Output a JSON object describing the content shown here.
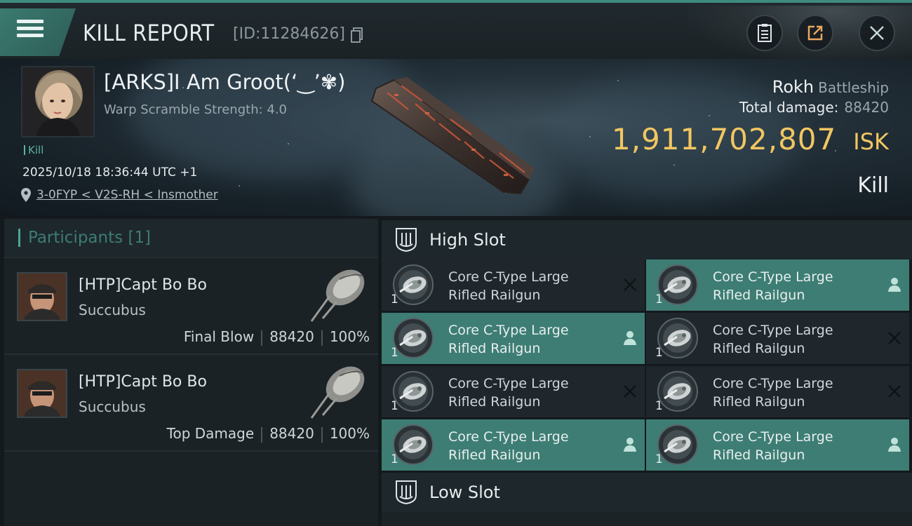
{
  "header": {
    "title": "KILL REPORT",
    "id_text": "[ID:11284626]"
  },
  "victim": {
    "name": "[ARKS]I Am Groot(‘‿’✾)",
    "warp_scramble": "Warp Scramble Strength: 4.0",
    "kill_tag": "Kill",
    "datetime": "2025/10/18 18:36:44 UTC +1",
    "location": "3-0FYP < V2S-RH < Insmother"
  },
  "ship": {
    "name": "Rokh",
    "class": "Battleship",
    "total_damage_label": "Total damage:",
    "total_damage": "88420",
    "isk_value": "1,911,702,807",
    "isk_unit": "ISK",
    "result": "Kill"
  },
  "participants": {
    "title": "Participants [1]",
    "items": [
      {
        "name": "[HTP]Capt Bo Bo",
        "ship": "Succubus",
        "role": "Final Blow",
        "damage": "88420",
        "percent": "100%"
      },
      {
        "name": "[HTP]Capt Bo Bo",
        "ship": "Succubus",
        "role": "Top Damage",
        "damage": "88420",
        "percent": "100%"
      }
    ]
  },
  "slots": {
    "high_title": "High Slot",
    "low_title": "Low Slot",
    "high_modules": [
      {
        "line1": "Core C-Type Large",
        "line2": "Rifled Railgun",
        "qty": "1",
        "status": "destroyed"
      },
      {
        "line1": "Core C-Type Large",
        "line2": "Rifled Railgun",
        "qty": "1",
        "status": "dropped"
      },
      {
        "line1": "Core C-Type Large",
        "line2": "Rifled Railgun",
        "qty": "1",
        "status": "dropped"
      },
      {
        "line1": "Core C-Type Large",
        "line2": "Rifled Railgun",
        "qty": "1",
        "status": "destroyed"
      },
      {
        "line1": "Core C-Type Large",
        "line2": "Rifled Railgun",
        "qty": "1",
        "status": "destroyed"
      },
      {
        "line1": "Core C-Type Large",
        "line2": "Rifled Railgun",
        "qty": "1",
        "status": "destroyed"
      },
      {
        "line1": "Core C-Type Large",
        "line2": "Rifled Railgun",
        "qty": "1",
        "status": "dropped"
      },
      {
        "line1": "Core C-Type Large",
        "line2": "Rifled Railgun",
        "qty": "1",
        "status": "dropped"
      }
    ]
  },
  "colors": {
    "accent": "#3d7d74",
    "isk_gold": "#f2c661",
    "kill_green": "#5fb39e"
  }
}
